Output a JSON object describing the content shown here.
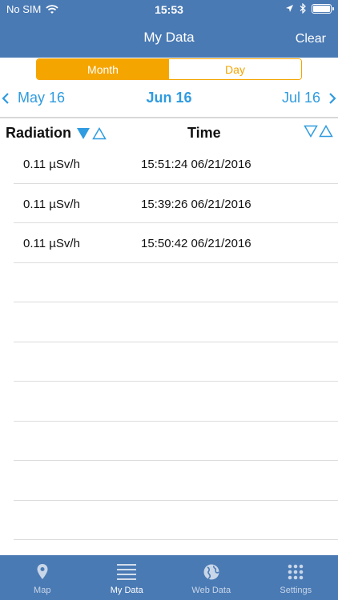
{
  "status_bar": {
    "carrier": "No SIM",
    "time": "15:53"
  },
  "nav": {
    "title": "My Data",
    "clear_label": "Clear"
  },
  "segment": {
    "options": [
      "Month",
      "Day"
    ],
    "selected": "Month"
  },
  "period": {
    "prev": "May 16",
    "current": "Jun 16",
    "next": "Jul 16"
  },
  "table": {
    "columns": [
      "Radiation",
      "Time"
    ],
    "rows": [
      {
        "radiation": "0.11 µSv/h",
        "time": "15:51:24 06/21/2016"
      },
      {
        "radiation": "0.11 µSv/h",
        "time": "15:39:26 06/21/2016"
      },
      {
        "radiation": "0.11 µSv/h",
        "time": "15:50:42 06/21/2016"
      },
      {
        "radiation": "",
        "time": ""
      },
      {
        "radiation": "",
        "time": ""
      },
      {
        "radiation": "",
        "time": ""
      },
      {
        "radiation": "",
        "time": ""
      },
      {
        "radiation": "",
        "time": ""
      },
      {
        "radiation": "",
        "time": ""
      },
      {
        "radiation": "",
        "time": ""
      }
    ]
  },
  "tabs": [
    {
      "label": "Map",
      "icon": "map-pin-icon"
    },
    {
      "label": "My Data",
      "icon": "list-icon"
    },
    {
      "label": "Web Data",
      "icon": "globe-icon"
    },
    {
      "label": "Settings",
      "icon": "grid-icon"
    }
  ],
  "active_tab": "My Data",
  "colors": {
    "nav_blue": "#4a7ab4",
    "accent_orange": "#f5a500",
    "link_blue": "#2f9be0"
  }
}
